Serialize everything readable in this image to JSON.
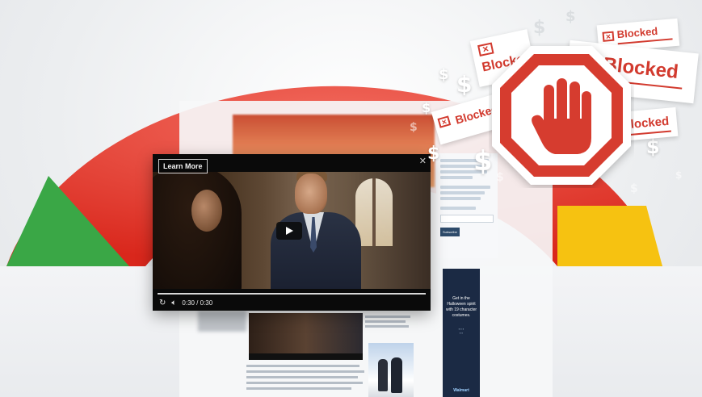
{
  "player": {
    "learn_more_label": "Learn More",
    "close_label": "✕",
    "time_display": "0:30 / 0:30",
    "progress_fraction": 1.0
  },
  "sidebar": {
    "subscribe_label": "Subscribe"
  },
  "ad": {
    "headline": "Get in the Halloween spirit with 19 character costumes.",
    "brand": "Walmart"
  },
  "blocked_tags": [
    {
      "label": "Blocked"
    },
    {
      "label": "Blocked"
    },
    {
      "label": "Blocked"
    },
    {
      "label": "Blocked"
    }
  ],
  "dollar_glyph": "$",
  "colors": {
    "arc_red": "#e8392c",
    "arc_green": "#3aa746",
    "arc_yellow": "#f6c211",
    "stop_red": "#d63c2f",
    "blocked_red": "#d23a2e"
  },
  "icons": {
    "stop": "hand-stop-icon",
    "replay": "replay-icon",
    "volume": "volume-icon",
    "play": "play-icon",
    "close": "close-icon"
  }
}
